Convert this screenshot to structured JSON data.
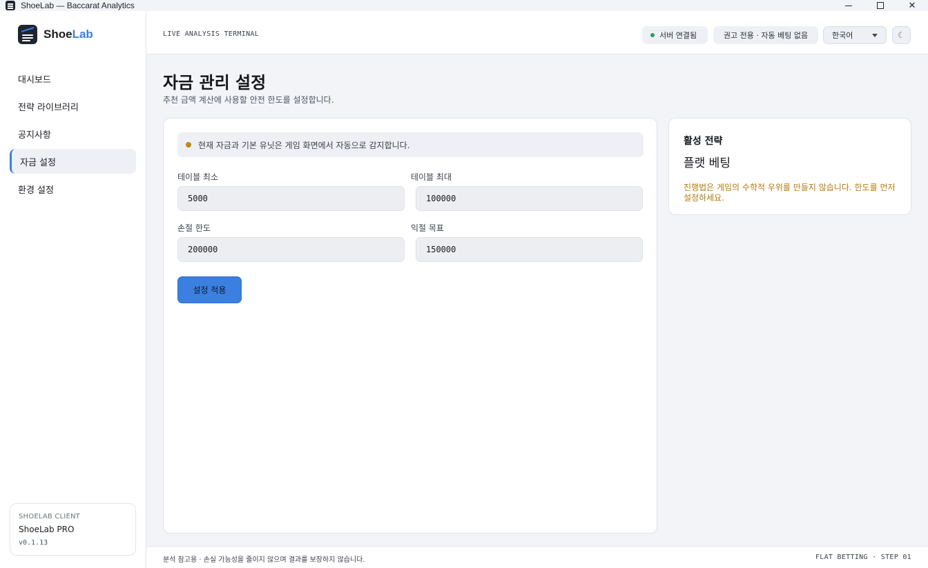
{
  "window": {
    "title": "ShoeLab — Baccarat Analytics"
  },
  "brand": {
    "name_part1": "Shoe",
    "name_part2": "Lab"
  },
  "sidebar": {
    "items": [
      {
        "label": "대시보드"
      },
      {
        "label": "전략 라이브러리"
      },
      {
        "label": "공지사항"
      },
      {
        "label": "자금 설정",
        "active": true
      },
      {
        "label": "환경 설정"
      }
    ],
    "client": {
      "label": "SHOELAB CLIENT",
      "name": "ShoeLab PRO",
      "version": "v0.1.13"
    }
  },
  "header": {
    "terminal_label": "LIVE ANALYSIS TERMINAL",
    "server_status": "서버 연결됨",
    "advice_mode": "권고 전용 · 자동 베팅 없음",
    "language": "한국어",
    "theme_toggle_glyph": "☾"
  },
  "page": {
    "title": "자금 관리 설정",
    "subtitle": "추천 금액 계산에 사용할 안전 한도를 설정합니다."
  },
  "form": {
    "notice": "현재 자금과 기본 유닛은 게임 화면에서 자동으로 감지합니다.",
    "table_min": {
      "label": "테이블 최소",
      "value": "5000"
    },
    "table_max": {
      "label": "테이블 최대",
      "value": "100000"
    },
    "stop_loss": {
      "label": "손절 한도",
      "value": "200000"
    },
    "take_profit": {
      "label": "익절 목표",
      "value": "150000"
    },
    "apply_label": "설정 적용"
  },
  "active_strategy": {
    "title": "활성 전략",
    "name": "플랫 베팅",
    "warning": "진행법은 게임의 수학적 우위를 만들지 않습니다. 한도를 먼저 설정하세요."
  },
  "footer": {
    "disclaimer": "분석 참고용 · 손실 가능성을 줄이지 않으며 결과를 보장하지 않습니다.",
    "step": "FLAT BETTING · STEP 01"
  },
  "colors": {
    "accent": "#3b7fe0",
    "status_connected": "#22a35a",
    "warning": "#b5790e"
  }
}
